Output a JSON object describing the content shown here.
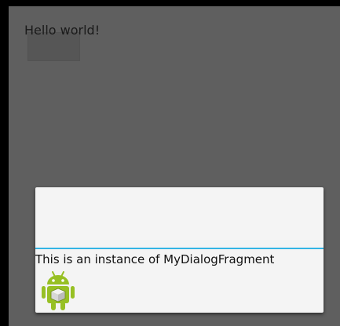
{
  "app": {
    "hello_text": "Hello world!",
    "hello_button_label": ""
  },
  "dialog": {
    "title": "",
    "message": "This is an instance of MyDialogFragment",
    "icon": "android-robot-icon",
    "divider_color": "#33b5e5"
  },
  "colors": {
    "dim_background": "#5f5f5f",
    "dialog_background": "#f4f4f4",
    "android_green": "#97c024"
  }
}
